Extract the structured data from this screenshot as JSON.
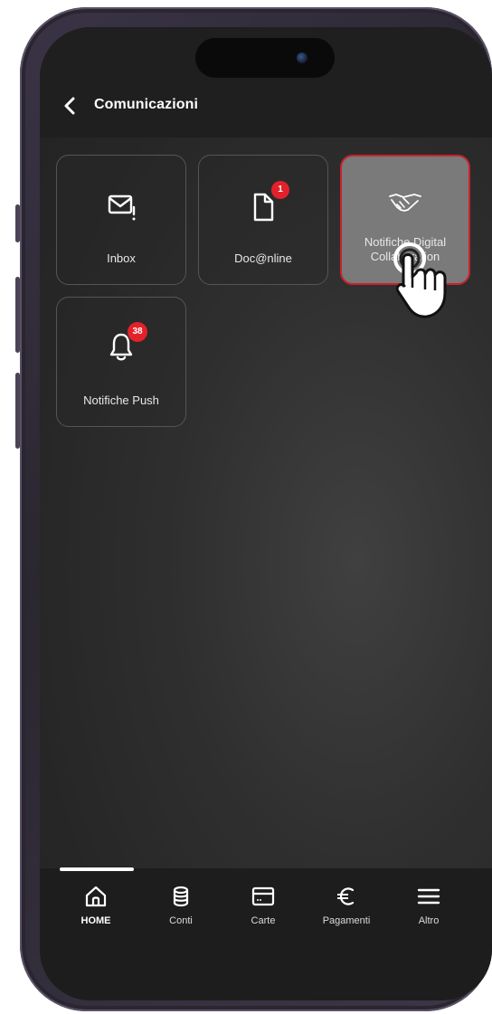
{
  "header": {
    "title": "Comunicazioni"
  },
  "tiles": [
    {
      "label": "Inbox",
      "badge": ""
    },
    {
      "label": "Doc@nline",
      "badge": "1"
    },
    {
      "label": "Notifiche Digital Collaboration",
      "badge": ""
    },
    {
      "label": "Notifiche Push",
      "badge": "38"
    }
  ],
  "tabbar": {
    "items": [
      {
        "label": "HOME",
        "icon": "home-icon"
      },
      {
        "label": "Conti",
        "icon": "database-icon"
      },
      {
        "label": "Carte",
        "icon": "card-icon"
      },
      {
        "label": "Pagamenti",
        "icon": "euro-icon"
      },
      {
        "label": "Altro",
        "icon": "menu-icon"
      }
    ]
  },
  "colors": {
    "accent": "#e3212a",
    "active_tile": "#7a7a7a",
    "background": "#262626"
  }
}
